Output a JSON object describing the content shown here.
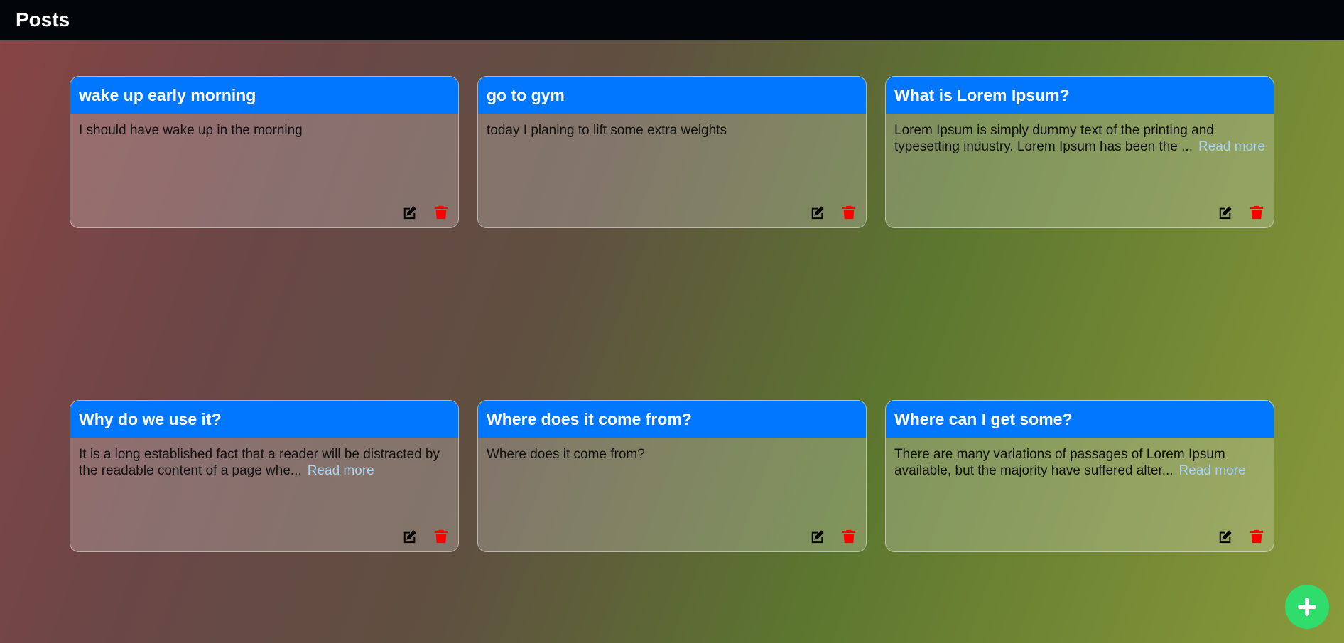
{
  "header": {
    "title": "Posts"
  },
  "posts": [
    {
      "title": "wake up early morning",
      "excerpt": "I should have wake up in the morning",
      "read_more": ""
    },
    {
      "title": "go to gym",
      "excerpt": "today I planing to lift some extra weights",
      "read_more": ""
    },
    {
      "title": "What is Lorem Ipsum?",
      "excerpt": "Lorem Ipsum is simply dummy text of the printing and typesetting industry. Lorem Ipsum has been the ...",
      "read_more": "Read more"
    },
    {
      "title": "Why do we use it?",
      "excerpt": "It is a long established fact that a reader will be distracted by the readable content of a page whe...",
      "read_more": "Read more"
    },
    {
      "title": "Where does it come from?",
      "excerpt": "Where does it come from?",
      "read_more": ""
    },
    {
      "title": "Where can I get some?",
      "excerpt": "There are many variations of passages of Lorem Ipsum available, but the majority have suffered alter...",
      "read_more": "Read more"
    }
  ],
  "icons": {
    "edit": "edit-icon",
    "delete": "trash-icon",
    "add": "plus-icon"
  },
  "colors": {
    "topbar": "#02060b",
    "card_header": "#0177fe",
    "delete": "#ff0000",
    "read_more": "#a8d3f2",
    "fab": "#2fdc6c"
  }
}
